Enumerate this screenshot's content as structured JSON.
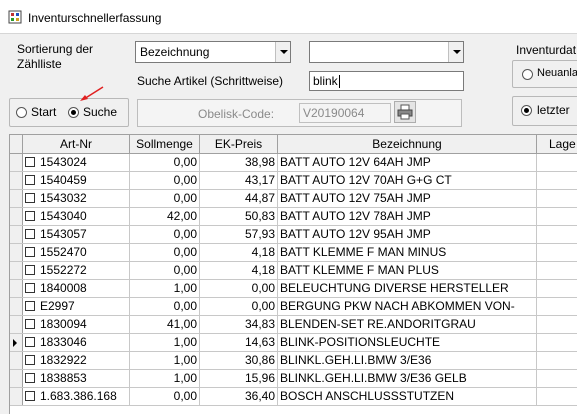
{
  "window": {
    "title": "Inventurschnellerfassung"
  },
  "form": {
    "sort_label": "Sortierung der Zählliste",
    "sort_value": "Bezeichnung",
    "second_combo_value": "",
    "search_label": "Suche Artikel (Schrittweise)",
    "search_value": "blink",
    "radio_start": "Start",
    "radio_suche": "Suche",
    "obelisk_label": "Obelisk-Code:",
    "obelisk_value": "V20190064",
    "inventurdat_label": "Inventurdat",
    "radio_neuanla": "Neuanla",
    "radio_letzter": "letzter"
  },
  "grid": {
    "columns": [
      "Art-Nr",
      "Sollmenge",
      "EK-Preis",
      "Bezeichnung",
      "Lage"
    ],
    "rows": [
      {
        "artnr": "1543024",
        "soll": "0,00",
        "ek": "38,98",
        "bez": "BATT AUTO 12V 64AH JMP"
      },
      {
        "artnr": "1540459",
        "soll": "0,00",
        "ek": "43,17",
        "bez": "BATT AUTO 12V 70AH G+G CT"
      },
      {
        "artnr": "1543032",
        "soll": "0,00",
        "ek": "44,87",
        "bez": "BATT AUTO 12V 75AH JMP"
      },
      {
        "artnr": "1543040",
        "soll": "42,00",
        "ek": "50,83",
        "bez": "BATT AUTO 12V 78AH JMP"
      },
      {
        "artnr": "1543057",
        "soll": "0,00",
        "ek": "57,93",
        "bez": "BATT AUTO 12V 95AH JMP"
      },
      {
        "artnr": "1552470",
        "soll": "0,00",
        "ek": "4,18",
        "bez": "BATT KLEMME F MAN MINUS"
      },
      {
        "artnr": "1552272",
        "soll": "0,00",
        "ek": "4,18",
        "bez": "BATT KLEMME F MAN PLUS"
      },
      {
        "artnr": "1840008",
        "soll": "1,00",
        "ek": "0,00",
        "bez": "BELEUCHTUNG DIVERSE HERSTELLER"
      },
      {
        "artnr": "E2997",
        "soll": "0,00",
        "ek": "0,00",
        "bez": "BERGUNG PKW NACH ABKOMMEN VON-"
      },
      {
        "artnr": "1830094",
        "soll": "41,00",
        "ek": "34,83",
        "bez": "BLENDEN-SET RE.ANDORITGRAU"
      },
      {
        "artnr": "1833046",
        "soll": "1,00",
        "ek": "14,63",
        "bez": "BLINK-POSITIONSLEUCHTE"
      },
      {
        "artnr": "1832922",
        "soll": "1,00",
        "ek": "30,86",
        "bez": "BLINKL.GEH.LI.BMW 3/E36"
      },
      {
        "artnr": "1838853",
        "soll": "1,00",
        "ek": "15,96",
        "bez": "BLINKL.GEH.LI.BMW 3/E36 GELB"
      },
      {
        "artnr": "1.683.386.168",
        "soll": "0,00",
        "ek": "36,40",
        "bez": "BOSCH ANSCHLUSSSTUTZEN"
      }
    ]
  },
  "colors": {
    "annotation_arrow": "#e02020"
  }
}
